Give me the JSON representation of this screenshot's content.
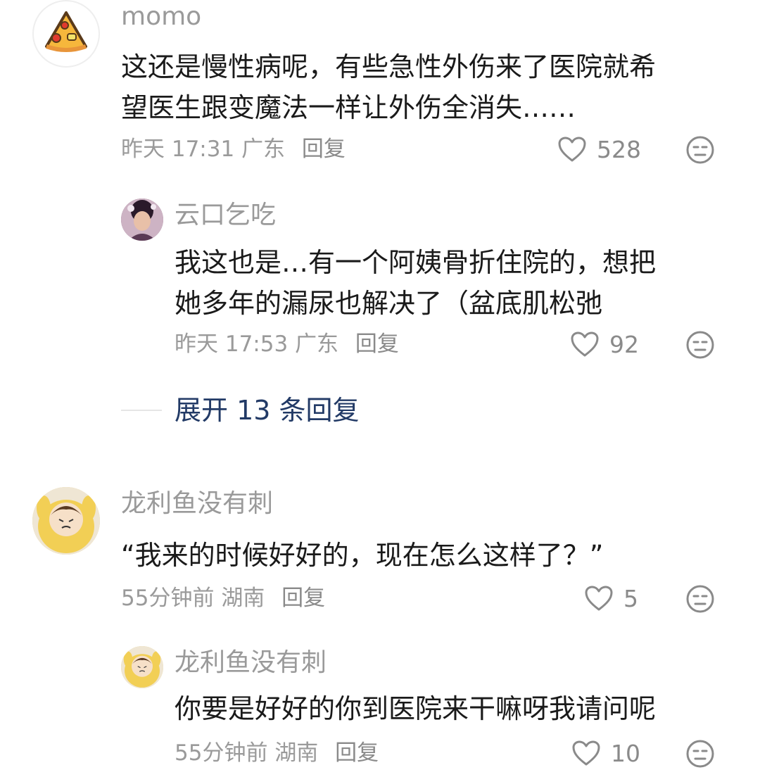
{
  "comments": [
    {
      "username": "momo",
      "text": "这还是慢性病呢，有些急性外伤来了医院就希\n望医生跟变魔法一样让外伤全消失……",
      "time": "昨天 17:31",
      "location": "广东",
      "reply_label": "回复",
      "likes": "528",
      "avatar_icon": "pizza-icon",
      "replies": [
        {
          "username": "云口乞吃",
          "text": "我这也是…有一个阿姨骨折住院的，想把\n她多年的漏尿也解决了（盆底肌松弛",
          "time": "昨天 17:53",
          "location": "广东",
          "reply_label": "回复",
          "likes": "92"
        }
      ],
      "expand_label": "展开 13 条回复"
    },
    {
      "username": "龙利鱼没有刺",
      "text": "“我来的时候好好的，现在怎么这样了？”",
      "time": "55分钟前",
      "location": "湖南",
      "reply_label": "回复",
      "likes": "5",
      "replies": [
        {
          "username": "龙利鱼没有刺",
          "text": "你要是好好的你到医院来干嘛呀我请问呢",
          "time": "55分钟前",
          "location": "湖南",
          "reply_label": "回复",
          "likes": "10"
        }
      ]
    }
  ],
  "icons": {
    "like": "heart-outline-icon",
    "dislike": "meh-face-icon"
  },
  "colors": {
    "username": "#9a9a9a",
    "text": "#1a1a1a",
    "expand": "#223a66"
  }
}
